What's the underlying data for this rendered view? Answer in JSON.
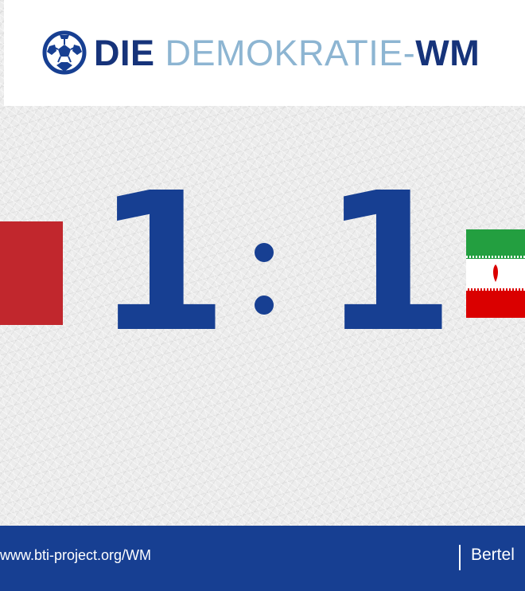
{
  "header": {
    "title_part1": "DIE",
    "title_part2": "DEMOKRATIE-",
    "title_part3": "WM",
    "logo_icon": "soccer-ball-icon"
  },
  "match": {
    "score_home": "1",
    "separator": ":",
    "score_away": "1",
    "left_flag_color": "#c1272d",
    "right_flag_colors": [
      "#239f40",
      "#ffffff",
      "#da0000"
    ]
  },
  "footer": {
    "url": "www.bti-project.org/WM",
    "brand": "Bertel"
  },
  "colors": {
    "primary": "#173f92",
    "light_accent": "#8db5d2",
    "background": "#ececec"
  }
}
